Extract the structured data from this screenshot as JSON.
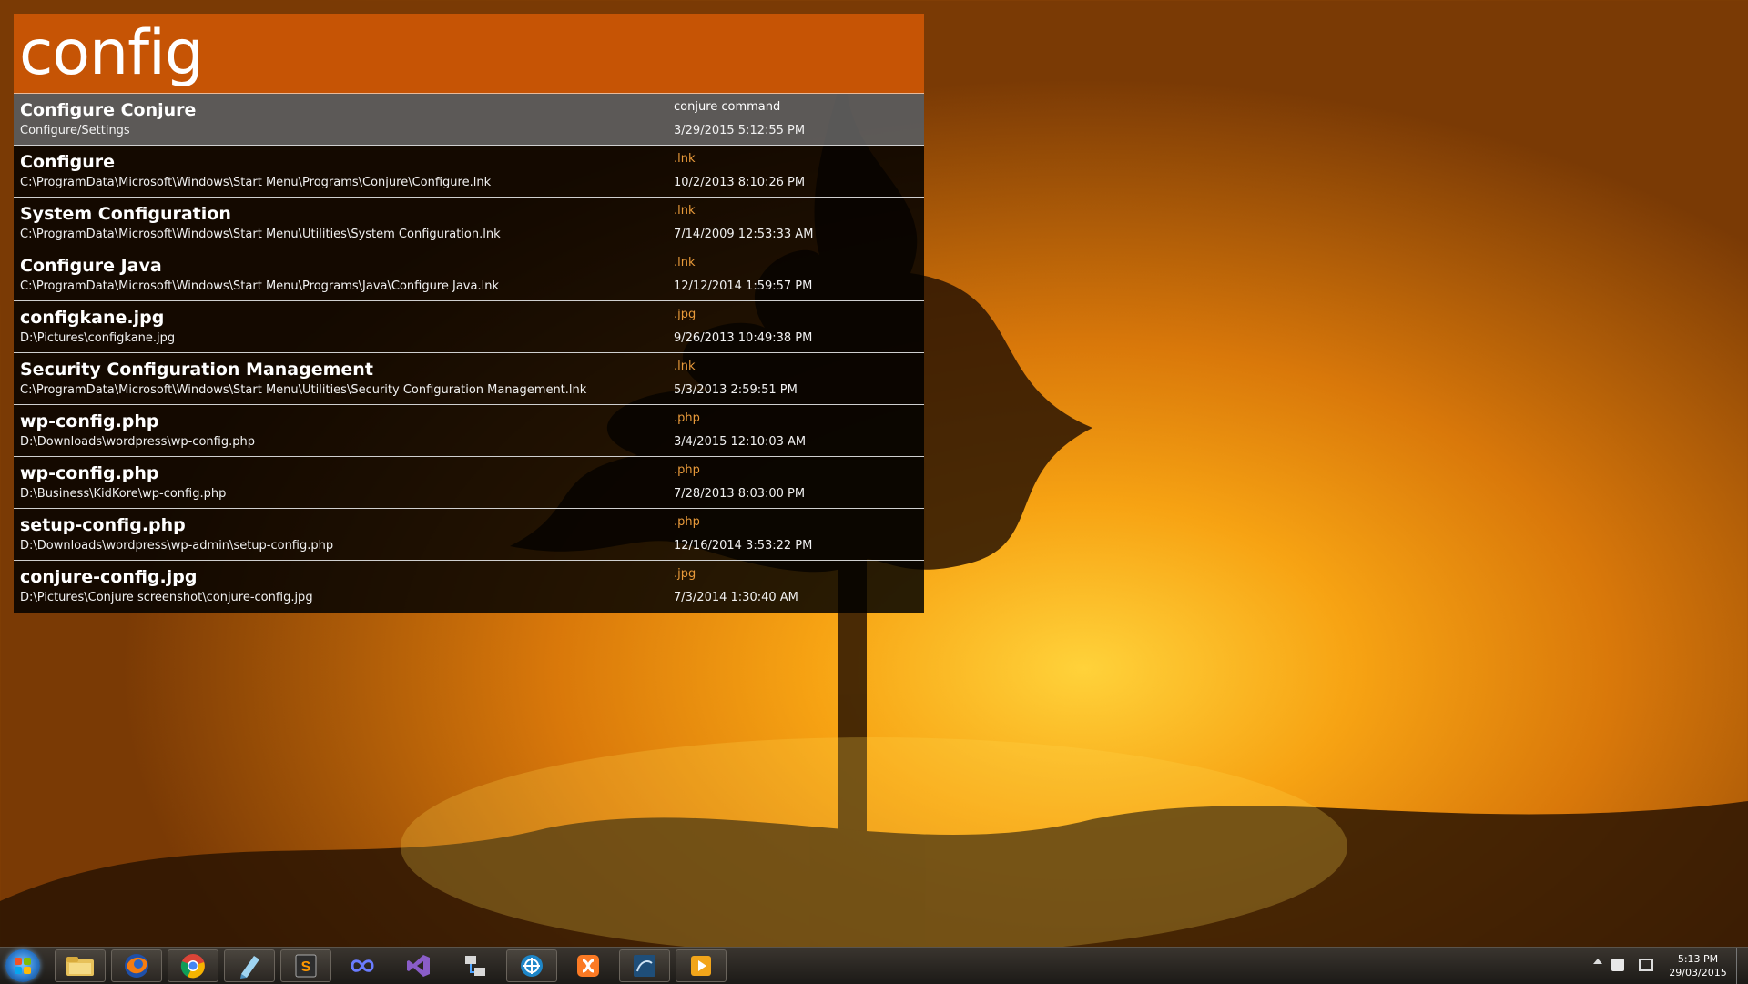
{
  "launcher": {
    "query": "config",
    "results": [
      {
        "title": "Configure Conjure",
        "path": "Configure/Settings",
        "type": "conjure command",
        "date": "3/29/2015 5:12:55 PM"
      },
      {
        "title": "Configure",
        "path": "C:\\ProgramData\\Microsoft\\Windows\\Start Menu\\Programs\\Conjure\\Configure.lnk",
        "type": ".lnk",
        "date": "10/2/2013 8:10:26 PM"
      },
      {
        "title": "System Configuration",
        "path": "C:\\ProgramData\\Microsoft\\Windows\\Start Menu\\Utilities\\System Configuration.lnk",
        "type": ".lnk",
        "date": "7/14/2009 12:53:33 AM"
      },
      {
        "title": "Configure Java",
        "path": "C:\\ProgramData\\Microsoft\\Windows\\Start Menu\\Programs\\Java\\Configure Java.lnk",
        "type": ".lnk",
        "date": "12/12/2014 1:59:57 PM"
      },
      {
        "title": "configkane.jpg",
        "path": "D:\\Pictures\\configkane.jpg",
        "type": ".jpg",
        "date": "9/26/2013 10:49:38 PM"
      },
      {
        "title": "Security Configuration Management",
        "path": "C:\\ProgramData\\Microsoft\\Windows\\Start Menu\\Utilities\\Security Configuration Management.lnk",
        "type": ".lnk",
        "date": "5/3/2013 2:59:51 PM"
      },
      {
        "title": "wp-config.php",
        "path": "D:\\Downloads\\wordpress\\wp-config.php",
        "type": ".php",
        "date": "3/4/2015 12:10:03 AM"
      },
      {
        "title": "wp-config.php",
        "path": "D:\\Business\\KidKore\\wp-config.php",
        "type": ".php",
        "date": "7/28/2013 8:03:00 PM"
      },
      {
        "title": "setup-config.php",
        "path": "D:\\Downloads\\wordpress\\wp-admin\\setup-config.php",
        "type": ".php",
        "date": "12/16/2014 3:53:22 PM"
      },
      {
        "title": "conjure-config.jpg",
        "path": "D:\\Pictures\\Conjure screenshot\\conjure-config.jpg",
        "type": ".jpg",
        "date": "7/3/2014 1:30:40 AM"
      }
    ],
    "selected_index": 0,
    "colors": {
      "accent": "#c65405",
      "type_text": "#e89a3a"
    }
  },
  "taskbar": {
    "start_icon": "windows-start-icon",
    "apps": [
      {
        "name": "file-explorer-icon",
        "icon": "folder"
      },
      {
        "name": "firefox-icon",
        "icon": "firefox"
      },
      {
        "name": "chrome-icon",
        "icon": "chrome"
      },
      {
        "name": "notepad-app-icon",
        "icon": "notepad"
      },
      {
        "name": "sublime-text-icon",
        "icon": "sublime",
        "label": "S"
      },
      {
        "name": "infinity-app-icon",
        "icon": "infinity"
      },
      {
        "name": "visual-studio-icon",
        "icon": "visual-studio"
      },
      {
        "name": "network-tool-icon",
        "icon": "network"
      },
      {
        "name": "app-blue-icon",
        "icon": "blue-circle"
      },
      {
        "name": "xampp-icon",
        "icon": "xampp"
      },
      {
        "name": "mysql-workbench-icon",
        "icon": "mysql"
      },
      {
        "name": "media-player-icon",
        "icon": "media"
      }
    ],
    "clock": {
      "time": "5:13 PM",
      "date": "29/03/2015"
    }
  }
}
